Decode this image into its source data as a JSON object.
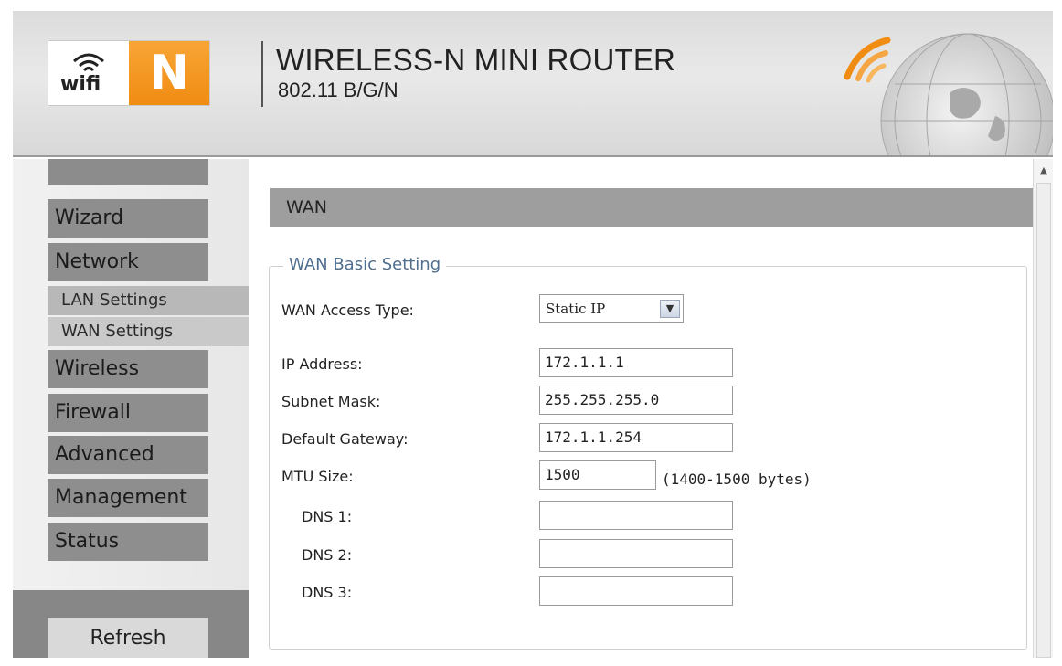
{
  "header": {
    "logo_wifi": "wifi",
    "logo_n": "N",
    "title": "WIRELESS-N MINI ROUTER",
    "subtitle": "802.11 B/G/N",
    "globe_icon": "globe-signal-icon"
  },
  "nav": {
    "items": [
      {
        "label": "Wizard"
      },
      {
        "label": "Network"
      },
      {
        "label": "LAN Settings"
      },
      {
        "label": "WAN Settings"
      },
      {
        "label": "Wireless"
      },
      {
        "label": "Firewall"
      },
      {
        "label": "Advanced"
      },
      {
        "label": "Management"
      },
      {
        "label": "Status"
      }
    ],
    "refresh_label": "Refresh"
  },
  "main": {
    "section_title": "WAN",
    "group_title": "WAN Basic Setting",
    "access_type_label": "WAN Access Type:",
    "access_type_value": "Static IP",
    "ip_label": "IP Address:",
    "ip_value": "172.1.1.1",
    "subnet_label": "Subnet Mask:",
    "subnet_value": "255.255.255.0",
    "gateway_label": "Default Gateway:",
    "gateway_value": "172.1.1.254",
    "mtu_label": "MTU Size:",
    "mtu_value": "1500",
    "mtu_hint": "(1400-1500 bytes)",
    "dns1_label": "DNS 1:",
    "dns1_value": "",
    "dns2_label": "DNS 2:",
    "dns2_value": "",
    "dns3_label": "DNS 3:",
    "dns3_value": ""
  },
  "colors": {
    "brand_orange": "#f08c12",
    "nav_button": "#8e8e8e",
    "section_bar": "#9e9e9e",
    "legend_text": "#4f6f8f"
  }
}
